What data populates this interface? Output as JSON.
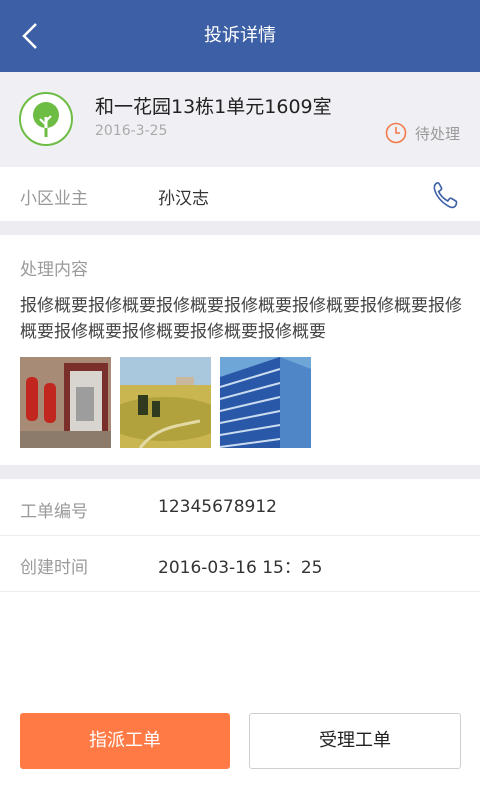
{
  "nav": {
    "title": "投诉详情",
    "back_icon": "back-arrow-icon"
  },
  "header": {
    "address": "和一花园13栋1单元1609室",
    "date": "2016-3-25",
    "status": "待处理",
    "logo_icon": "tree-icon",
    "status_icon": "clock-icon",
    "status_color": "#f07a4a",
    "logo_color": "#6dbd44"
  },
  "owner": {
    "label": "小区业主",
    "name": "孙汉志",
    "phone_icon": "phone-icon"
  },
  "content": {
    "label": "处理内容",
    "text": "报修概要报修概要报修概要报修概要报修概要报修概要报修概要报修概要报修概要报修概要报修概要",
    "images": [
      "fire-extinguisher-photo",
      "countryside-photo",
      "building-photo"
    ]
  },
  "info": [
    {
      "label": "工单编号",
      "value": "12345678912"
    },
    {
      "label": "创建时间",
      "value": "2016-03-16  15：25"
    }
  ],
  "actions": {
    "assign_label": "指派工单",
    "accept_label": "受理工单",
    "primary_color": "#ff7a45"
  }
}
